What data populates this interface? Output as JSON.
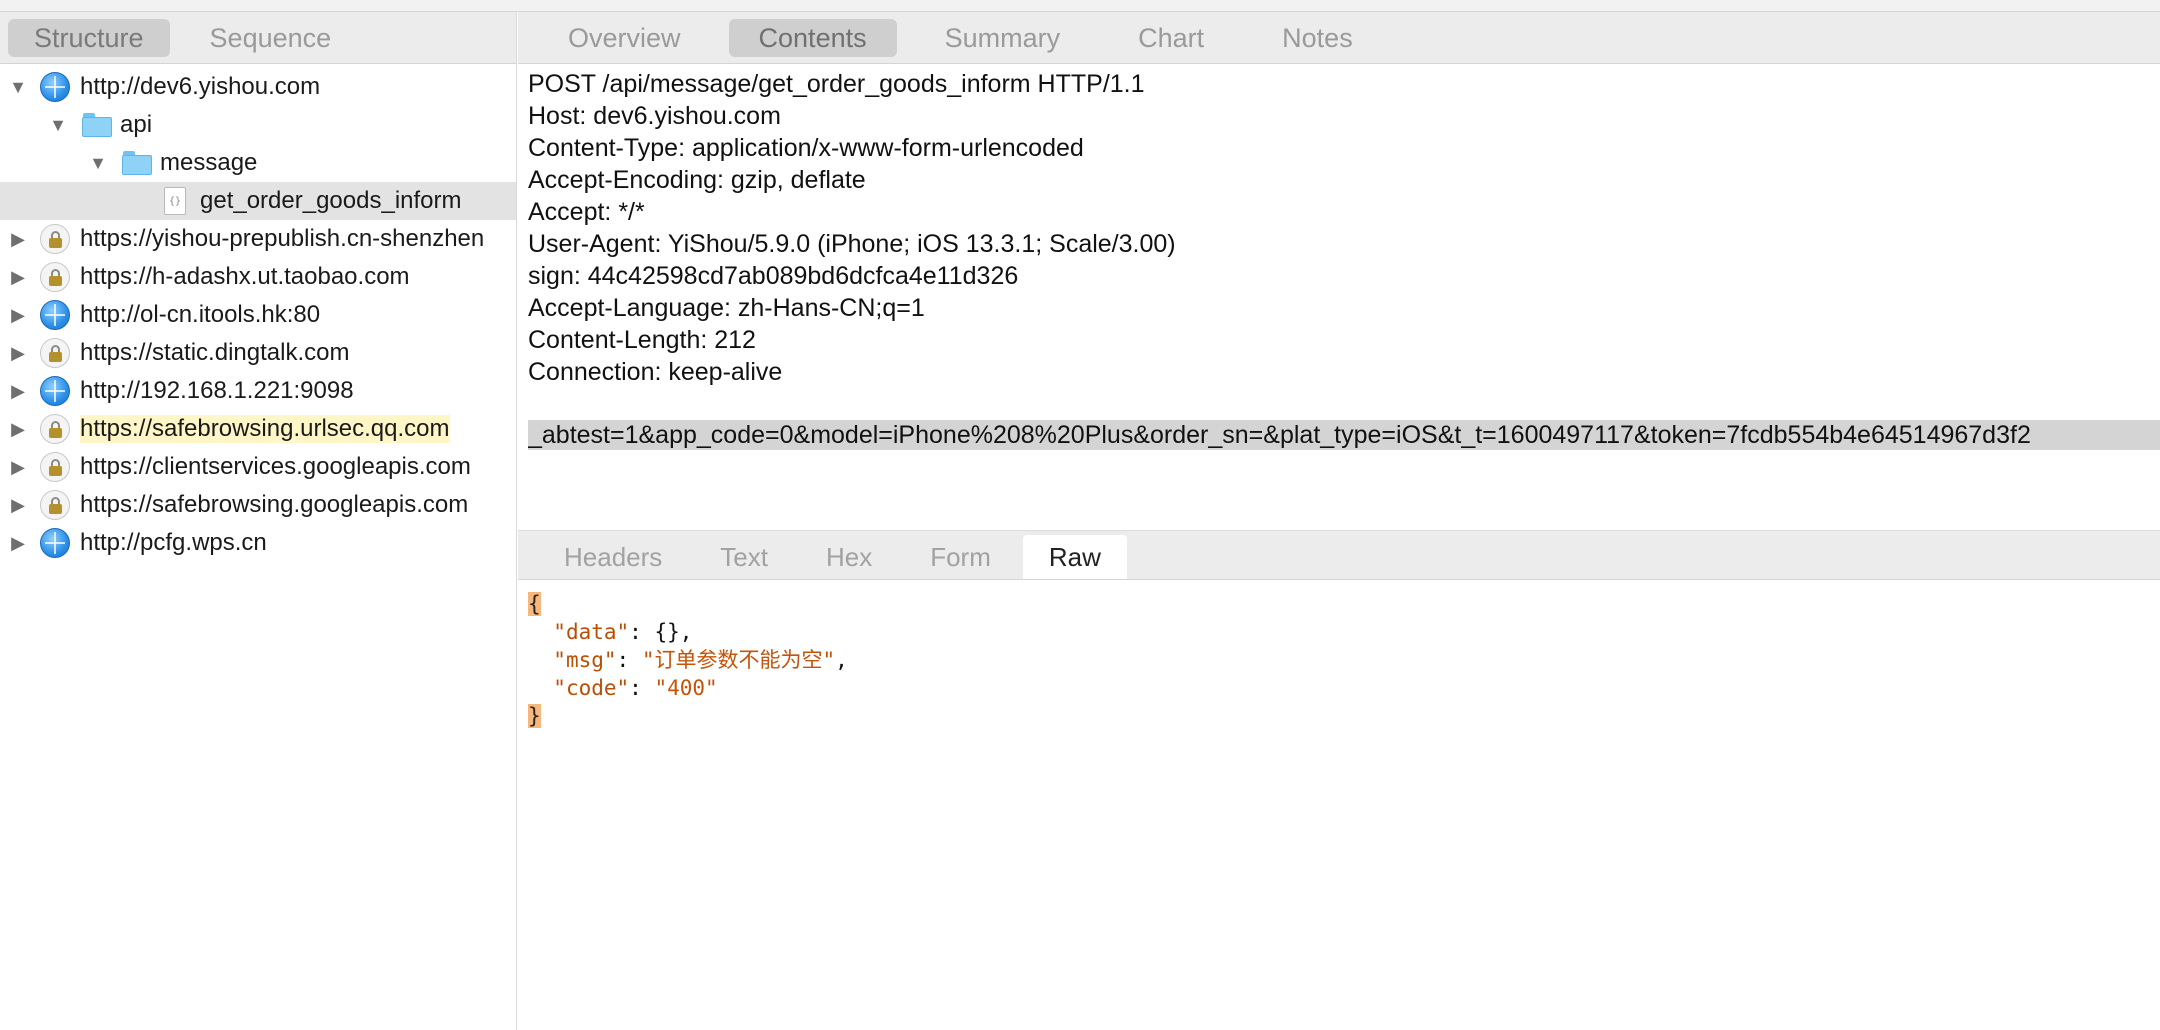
{
  "left_tabs": [
    "Structure",
    "Sequence"
  ],
  "tree": [
    {
      "label": "http://dev6.yishou.com",
      "icon": "globe-icon",
      "level": 0,
      "expanded": true
    },
    {
      "label": "api",
      "icon": "folder-icon",
      "level": 1,
      "expanded": true
    },
    {
      "label": "message",
      "icon": "folder-icon",
      "level": 2,
      "expanded": true
    },
    {
      "label": "get_order_goods_inform",
      "icon": "file-icon",
      "level": 3,
      "selected": true
    },
    {
      "label": "https://yishou-prepublish.cn-shenzhen",
      "icon": "lock-icon",
      "level": 0
    },
    {
      "label": "https://h-adashx.ut.taobao.com",
      "icon": "lock-icon",
      "level": 0
    },
    {
      "label": "http://ol-cn.itools.hk:80",
      "icon": "globe-icon",
      "level": 0
    },
    {
      "label": "https://static.dingtalk.com",
      "icon": "lock-icon",
      "level": 0
    },
    {
      "label": "http://192.168.1.221:9098",
      "icon": "globe-icon",
      "level": 0
    },
    {
      "label": "https://safebrowsing.urlsec.qq.com",
      "icon": "lock-icon",
      "level": 0,
      "highlighted": true
    },
    {
      "label": "https://clientservices.googleapis.com",
      "icon": "lock-icon",
      "level": 0
    },
    {
      "label": "https://safebrowsing.googleapis.com",
      "icon": "lock-icon",
      "level": 0
    },
    {
      "label": "http://pcfg.wps.cn",
      "icon": "globe-icon",
      "level": 0
    }
  ],
  "right_tabs": [
    "Overview",
    "Contents",
    "Summary",
    "Chart",
    "Notes"
  ],
  "request_lines": [
    "POST /api/message/get_order_goods_inform HTTP/1.1",
    "Host: dev6.yishou.com",
    "Content-Type: application/x-www-form-urlencoded",
    "Accept-Encoding: gzip, deflate",
    "Accept: */*",
    "User-Agent: YiShou/5.9.0 (iPhone; iOS 13.3.1; Scale/3.00)",
    "sign: 44c42598cd7ab089bd6dcfca4e11d326",
    "Accept-Language: zh-Hans-CN;q=1",
    "Content-Length: 212",
    "Connection: keep-alive"
  ],
  "request_body": "_abtest=1&app_code=0&model=iPhone%208%20Plus&order_sn=&plat_type=iOS&t_t=1600497117&token=7fcdb554b4e64514967d3f2",
  "sub_tabs": [
    "Headers",
    "Text",
    "Hex",
    "Form",
    "Raw"
  ],
  "response": {
    "open": "{",
    "close": "}",
    "fields": [
      {
        "key": "\"data\"",
        "value": "{}",
        "suffix": ","
      },
      {
        "key": "\"msg\"",
        "value": "\"订单参数不能为空\"",
        "suffix": ","
      },
      {
        "key": "\"code\"",
        "value": "\"400\"",
        "suffix": ""
      }
    ]
  }
}
